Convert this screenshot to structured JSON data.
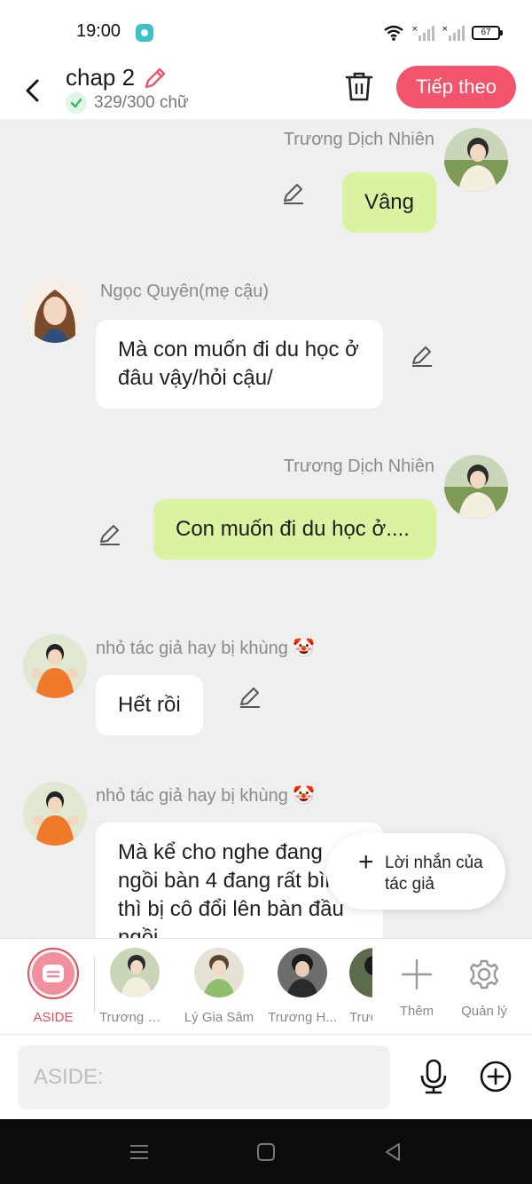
{
  "status_bar": {
    "time": "19:00",
    "battery": "67"
  },
  "header": {
    "title": "chap 2",
    "word_count": "329/300 chữ",
    "next_label": "Tiếp theo"
  },
  "messages": [
    {
      "sender": "Trương Dịch Nhiên",
      "side": "right",
      "text": "Vâng"
    },
    {
      "sender": "Ngọc Quyên(mẹ cậu)",
      "side": "left",
      "text": "Mà con muốn đi du học ở đâu vậy/hỏi cậu/"
    },
    {
      "sender": "Trương Dịch Nhiên",
      "side": "right",
      "text": "Con muốn đi du học ở...."
    },
    {
      "sender": "nhỏ tác giả hay bị khùng 🤡",
      "side": "left",
      "text": "Hết rồi"
    },
    {
      "sender": "nhỏ tác giả hay bị khùng 🤡",
      "side": "left",
      "text": "Mà kể cho nghe đang ngồi bàn 4 đang rất bình thì bị cô đổi lên bàn đầu ngồi"
    }
  ],
  "author_note": {
    "label": "Lời nhắn của tác giả"
  },
  "characters": {
    "aside_label": "ASIDE",
    "items": [
      {
        "name": "Trương Dị..."
      },
      {
        "name": "Lý Gia Sâm"
      },
      {
        "name": "Trương H..."
      },
      {
        "name": "Trươ"
      }
    ],
    "add_label": "Thêm",
    "manage_label": "Quản lý"
  },
  "input": {
    "placeholder": "ASIDE:"
  },
  "icons": {
    "back": "back-arrow-icon",
    "edit": "pencil-icon",
    "trash": "trash-icon",
    "check": "check-icon",
    "mic": "microphone-icon",
    "plus_circle": "plus-circle-icon",
    "gear": "gear-icon"
  },
  "colors": {
    "accent": "#f2546c",
    "bubble_right": "#d9f3a0",
    "bubble_left": "#ffffff",
    "aside_red": "#e24e5a"
  }
}
